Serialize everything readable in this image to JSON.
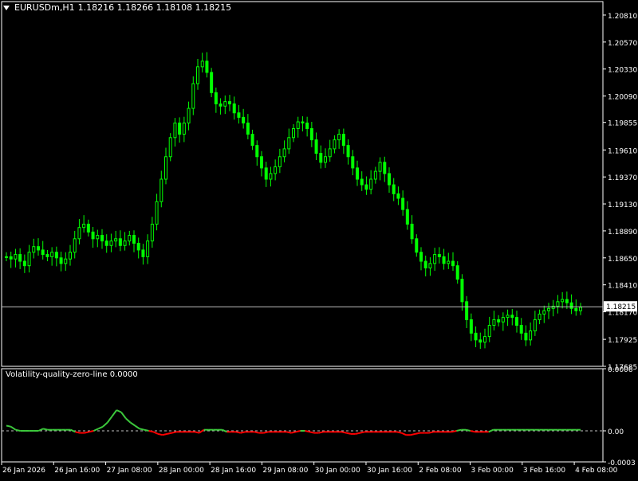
{
  "title": {
    "symbol_timeframe": "EURUSDm,H1",
    "ohlc": "1.18216 1.18266 1.18108 1.18215"
  },
  "indicator": {
    "label": "Volatility-quality-zero-line 0.0000",
    "y_ticks": [
      "0.0006",
      "0.00",
      "-0.0003"
    ]
  },
  "price_axis": {
    "ticks": [
      "1.20810",
      "1.20570",
      "1.20330",
      "1.20090",
      "1.19855",
      "1.19610",
      "1.19370",
      "1.19130",
      "1.18890",
      "1.18650",
      "1.18410",
      "1.18170",
      "1.17925",
      "1.17685"
    ],
    "current_price": "1.18215"
  },
  "time_axis": {
    "ticks": [
      "26 Jan 2026",
      "26 Jan 16:00",
      "27 Jan 08:00",
      "28 Jan 00:00",
      "28 Jan 16:00",
      "29 Jan 08:00",
      "30 Jan 00:00",
      "30 Jan 16:00",
      "2 Feb 08:00",
      "3 Feb 00:00",
      "3 Feb 16:00",
      "4 Feb 08:00"
    ]
  },
  "colors": {
    "background": "#000000",
    "bull": "#00ff00",
    "indicator_up": "#3cc83c",
    "indicator_down": "#ff0000",
    "axis": "#ffffff"
  },
  "chart_data": {
    "type": "candlestick",
    "price_series": [
      1.1866,
      1.1864,
      1.1868,
      1.1862,
      1.1858,
      1.187,
      1.1875,
      1.1872,
      1.1868,
      1.1866,
      1.187,
      1.1865,
      1.186,
      1.1864,
      1.187,
      1.1882,
      1.1892,
      1.1895,
      1.1888,
      1.1882,
      1.1885,
      1.188,
      1.1876,
      1.188,
      1.1882,
      1.1876,
      1.188,
      1.1885,
      1.1878,
      1.1872,
      1.1866,
      1.188,
      1.1895,
      1.1915,
      1.1935,
      1.1955,
      1.1972,
      1.1985,
      1.1975,
      1.1985,
      1.1998,
      1.202,
      1.2035,
      1.204,
      1.203,
      1.2012,
      1.2002,
      1.2,
      1.2004,
      1.2002,
      1.1994,
      1.199,
      1.1985,
      1.1975,
      1.1965,
      1.1955,
      1.1945,
      1.1935,
      1.194,
      1.1946,
      1.1955,
      1.1962,
      1.1972,
      1.198,
      1.1986,
      1.1985,
      1.198,
      1.197,
      1.1958,
      1.195,
      1.1955,
      1.1962,
      1.197,
      1.1975,
      1.1965,
      1.1955,
      1.1945,
      1.1935,
      1.193,
      1.1926,
      1.1935,
      1.1942,
      1.195,
      1.194,
      1.193,
      1.1922,
      1.1918,
      1.1908,
      1.1895,
      1.1882,
      1.187,
      1.1862,
      1.1856,
      1.186,
      1.1868,
      1.1866,
      1.186,
      1.1862,
      1.1858,
      1.1846,
      1.1826,
      1.181,
      1.1798,
      1.1792,
      1.179,
      1.1795,
      1.1805,
      1.181,
      1.1808,
      1.1812,
      1.1814,
      1.1812,
      1.1805,
      1.1798,
      1.1792,
      1.18,
      1.181,
      1.1815,
      1.1818,
      1.182,
      1.1822,
      1.1826,
      1.1828,
      1.1825,
      1.182,
      1.1818,
      1.1821
    ],
    "indicator_series": [
      5e-05,
      4e-05,
      1e-05,
      0.0,
      0.0,
      0.0,
      0.0,
      0.0,
      2e-05,
      1e-05,
      1e-05,
      1e-05,
      1e-05,
      1e-05,
      1e-05,
      -1e-05,
      -2e-05,
      -2e-05,
      -1e-05,
      0.0,
      2e-05,
      4e-05,
      8e-05,
      0.00014,
      0.0002,
      0.00018,
      0.00012,
      8e-05,
      5e-05,
      2e-05,
      1e-05,
      0.0,
      -1e-05,
      -3e-05,
      -4e-05,
      -3e-05,
      -2e-05,
      -1e-05,
      -1e-05,
      -1e-05,
      -1e-05,
      -1e-05,
      -2e-05,
      1e-05,
      1e-05,
      1e-05,
      1e-05,
      1e-05,
      -1e-05,
      -1e-05,
      -1e-05,
      -2e-05,
      -1e-05,
      -1e-05,
      -1e-05,
      -2e-05,
      -2e-05,
      -1e-05,
      -1e-05,
      -1e-05,
      -1e-05,
      -1e-05,
      -2e-05,
      -1e-05,
      0.0,
      0.0,
      -1e-05,
      -2e-05,
      -2e-05,
      -1e-05,
      -1e-05,
      -1e-05,
      -1e-05,
      -1e-05,
      -2e-05,
      -3e-05,
      -3e-05,
      -2e-05,
      -1e-05,
      -1e-05,
      -1e-05,
      -1e-05,
      -1e-05,
      -1e-05,
      -1e-05,
      -1e-05,
      -2e-05,
      -4e-05,
      -4e-05,
      -3e-05,
      -2e-05,
      -2e-05,
      -2e-05,
      -1e-05,
      -1e-05,
      -1e-05,
      -1e-05,
      -1e-05,
      0.0,
      1e-05,
      1e-05,
      0.0,
      -1e-05,
      -1e-05,
      -1e-05,
      -1e-05,
      1e-05,
      1e-05,
      1e-05,
      1e-05,
      1e-05,
      1e-05,
      1e-05,
      1e-05,
      1e-05,
      1e-05,
      1e-05,
      1e-05,
      1e-05,
      1e-05,
      1e-05,
      1e-05,
      1e-05,
      1e-05,
      1e-05,
      1e-05
    ],
    "price_range": [
      1.17685,
      1.2093
    ],
    "indicator_range": [
      -0.0003,
      0.0006
    ],
    "zero_line": 0.0
  }
}
